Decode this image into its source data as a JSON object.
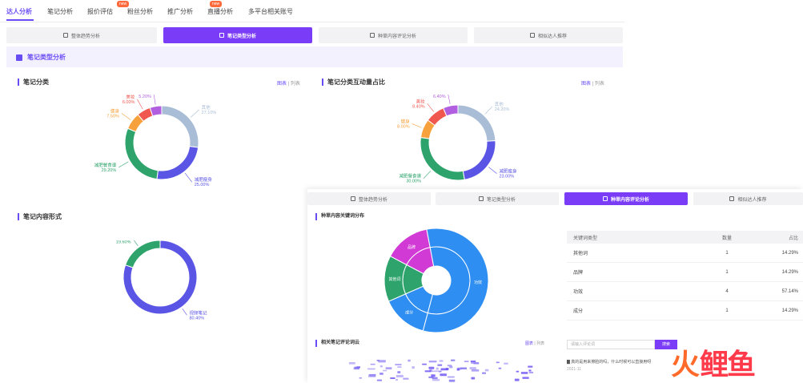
{
  "nav": {
    "tabs": [
      "达人分析",
      "笔记分析",
      "报价评估",
      "粉丝分析",
      "推广分析",
      "直播分析",
      "多平台相关账号"
    ],
    "active": 0,
    "badges": [
      "new",
      "new"
    ]
  },
  "segments": {
    "items": [
      "整体趋势分析",
      "笔记类型分析",
      "种草内容评论分析",
      "相似达人推荐"
    ],
    "active": 1
  },
  "section": {
    "title": "笔记类型分析"
  },
  "card1": {
    "title": "笔记分类",
    "toggle_chart": "图表",
    "toggle_list": "列表"
  },
  "card2": {
    "title": "笔记分类互动量占比",
    "toggle_chart": "图表",
    "toggle_list": "列表"
  },
  "card3": {
    "title": "笔记内容形式"
  },
  "overlay": {
    "segments": [
      "整体趋势分析",
      "笔记类型分析",
      "种草内容评论分析",
      "相似达人推荐"
    ],
    "active": 2,
    "sunburst_title": "种草内容关键词分布",
    "cloud_title": "相关笔记评论词云",
    "cloud_toggle_chart": "图表",
    "cloud_toggle_list": "列表",
    "table": {
      "headers": [
        "关键词类型",
        "数量",
        "占比"
      ],
      "rows": [
        [
          "其他词",
          "1",
          "14.29%"
        ],
        [
          "品牌",
          "1",
          "14.29%"
        ],
        [
          "功效",
          "4",
          "57.14%"
        ],
        [
          "成分",
          "1",
          "14.29%"
        ]
      ]
    },
    "search_placeholder": "请输入评论词",
    "search_button": "搜索",
    "comments": [
      "▇ 真的是用来擦脸的吗，什么时候可以直接用呀",
      "2021-11"
    ]
  },
  "logo": {
    "text_fire": "火",
    "text_rest": "鲤鱼"
  },
  "chart_data": [
    {
      "type": "pie",
      "title": "笔记分类",
      "slices": [
        {
          "label": "其他",
          "value": 27.1,
          "color": "#a9bdd6"
        },
        {
          "label": "减肥瘦身",
          "value": 25.0,
          "color": "#5b55e6"
        },
        {
          "label": "减肥餐食谱",
          "value": 29.2,
          "color": "#2ea36c"
        },
        {
          "label": "健身",
          "value": 7.5,
          "color": "#f6a13c"
        },
        {
          "label": "美妆",
          "value": 6.0,
          "color": "#f0574f"
        },
        {
          "label": "其他类",
          "value": 5.2,
          "color": "#b15ee0"
        }
      ]
    },
    {
      "type": "pie",
      "title": "笔记分类互动量占比",
      "slices": [
        {
          "label": "其他",
          "value": 24.2,
          "color": "#a9bdd6"
        },
        {
          "label": "减肥瘦身",
          "value": 23.0,
          "color": "#5b55e6"
        },
        {
          "label": "减肥餐食谱",
          "value": 30.0,
          "color": "#2ea36c"
        },
        {
          "label": "健身",
          "value": 8.0,
          "color": "#f6a13c"
        },
        {
          "label": "美妆",
          "value": 8.4,
          "color": "#f0574f"
        },
        {
          "label": "其他类",
          "value": 6.4,
          "color": "#b15ee0"
        }
      ]
    },
    {
      "type": "pie",
      "title": "笔记内容形式",
      "slices": [
        {
          "label": "视频笔记",
          "value": 80.4,
          "color": "#5b55e6"
        },
        {
          "label": "图文笔记",
          "value": 19.6,
          "color": "#2ea36c"
        }
      ]
    },
    {
      "type": "sunburst",
      "title": "种草内容关键词分布",
      "slices": [
        {
          "label": "功效",
          "value": 57.14,
          "color": "#2f8ef2"
        },
        {
          "label": "成分",
          "value": 14.29,
          "color": "#2f8ef2"
        },
        {
          "label": "其他词",
          "value": 14.29,
          "color": "#2ea36c"
        },
        {
          "label": "品牌",
          "value": 14.29,
          "color": "#d23ad6"
        }
      ]
    }
  ],
  "colors": {
    "accent": "#7b3cf7",
    "accent_soft": "#f4f1fe"
  }
}
